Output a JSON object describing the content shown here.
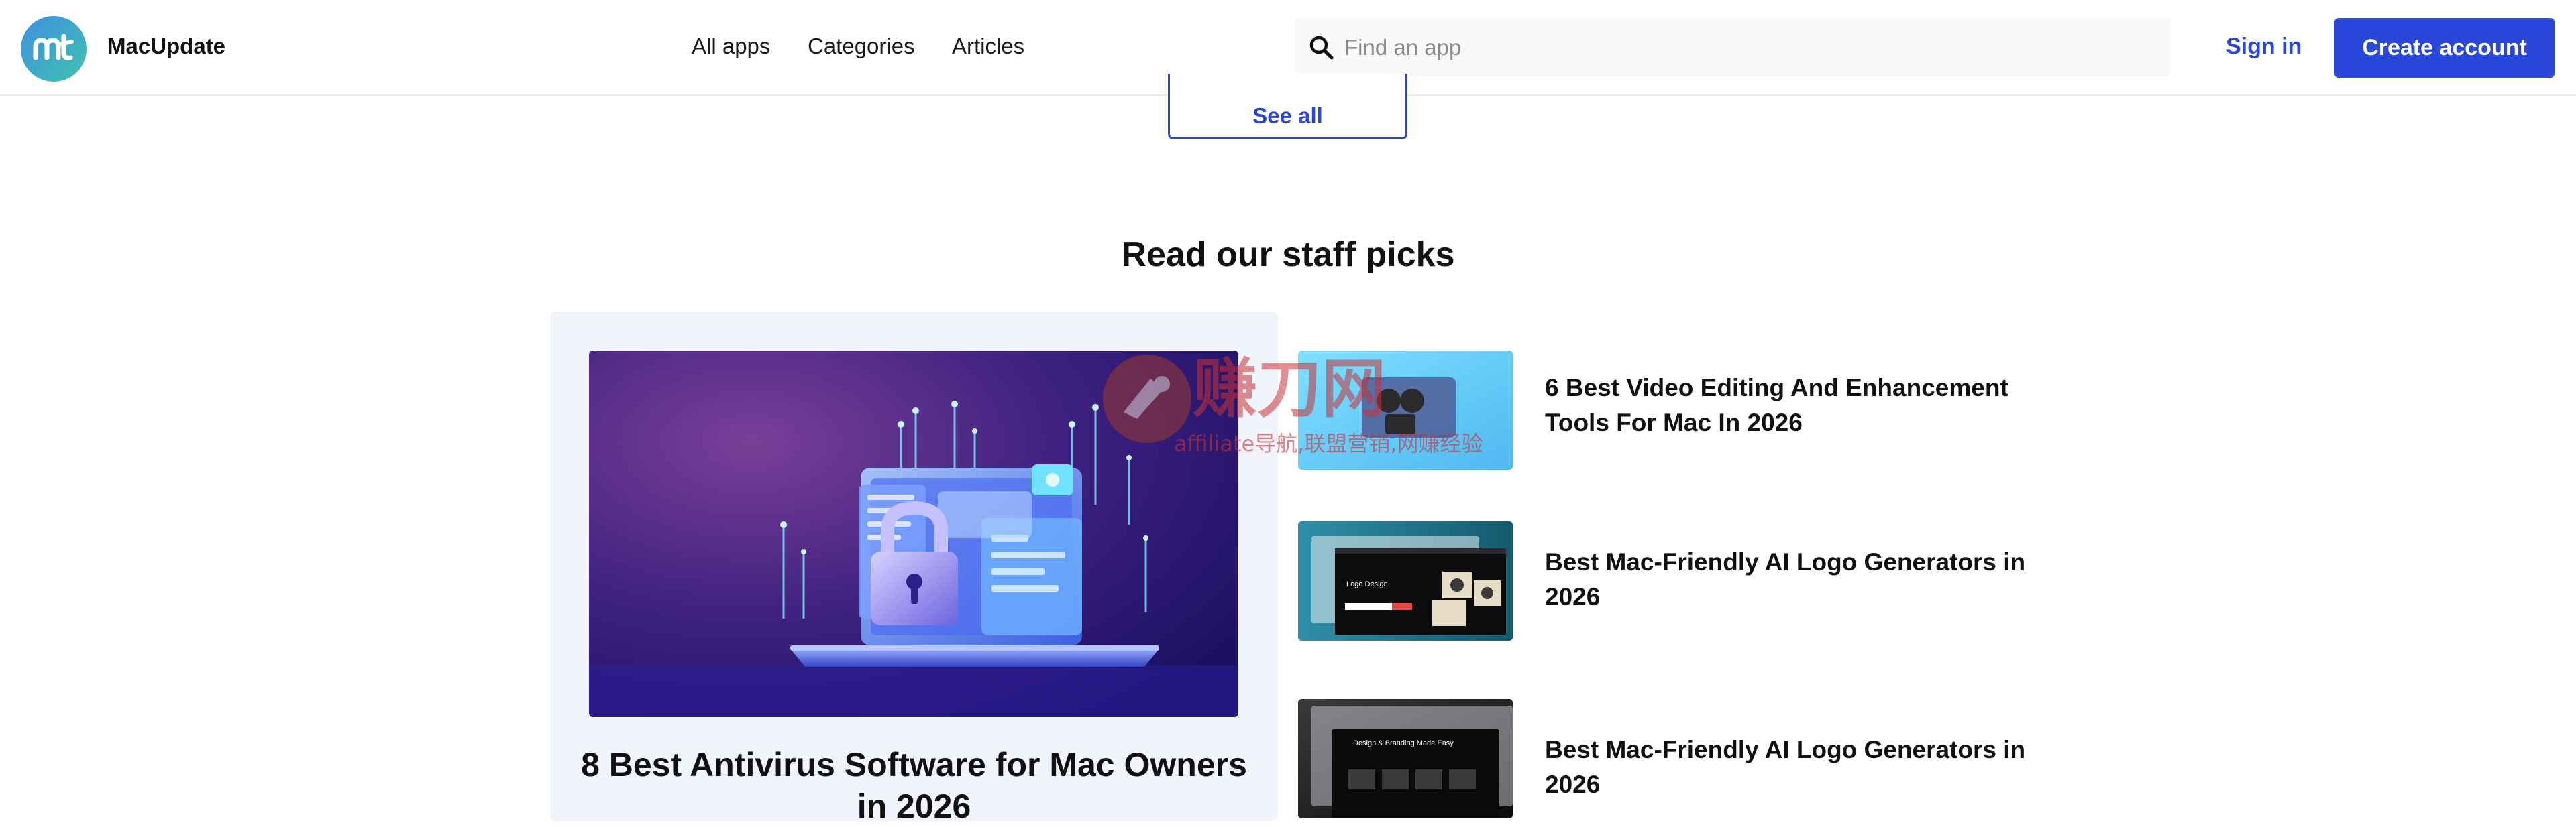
{
  "header": {
    "brand": "MacUpdate",
    "nav": [
      "All apps",
      "Categories",
      "Articles"
    ],
    "search_placeholder": "Find an app",
    "sign_in": "Sign in",
    "create_account": "Create account"
  },
  "see_all": "See all",
  "staff_picks": {
    "title": "Read our staff picks",
    "featured": {
      "title": "8 Best Antivirus Software for Mac Owners in 2026"
    },
    "articles": [
      {
        "title": "6 Best Video Editing And Enhancement Tools For Mac In 2026"
      },
      {
        "title": "Best Mac-Friendly AI Logo Generators in 2026",
        "thumb_text": "Logo Design"
      },
      {
        "title": "Best Mac-Friendly AI Logo Generators in 2026",
        "thumb_text": "Design & Branding Made Easy"
      }
    ]
  },
  "watermark": {
    "main": "赚刀网",
    "sub": "affiliate导航,联盟营销,网赚经验"
  },
  "colors": {
    "accent": "#2947d8",
    "logo_gradient": [
      "#3f8fe0",
      "#3fc2b0"
    ],
    "feature_card_bg": "#f1f5fb",
    "search_bg": "#fbf9f7"
  }
}
